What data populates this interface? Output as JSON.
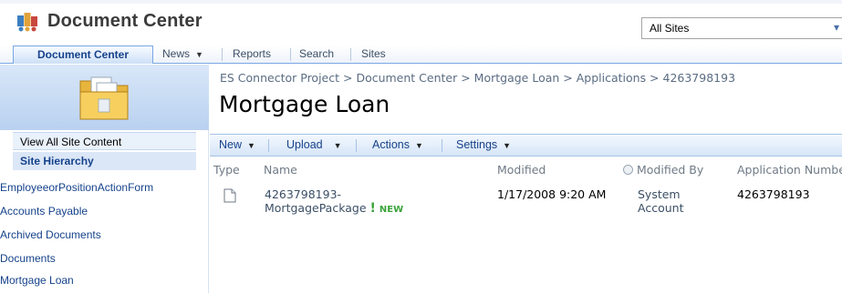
{
  "header": {
    "site_title": "Document Center",
    "scope_select": {
      "selected": "All Sites"
    }
  },
  "topnav": {
    "tabs": [
      {
        "label": "Document Center",
        "active": true
      },
      {
        "label": "News",
        "has_dropdown": true
      },
      {
        "label": "Reports"
      },
      {
        "label": "Search"
      },
      {
        "label": "Sites"
      }
    ]
  },
  "sidebar": {
    "view_all": "View All Site Content",
    "hierarchy_heading": "Site Hierarchy",
    "items": [
      "EmployeeorPositionActionForm",
      "Accounts Payable",
      "Archived Documents",
      "Documents",
      "Mortgage Loan"
    ]
  },
  "main": {
    "breadcrumb": "ES Connector Project > Document Center > Mortgage Loan > Applications > 4263798193",
    "title": "Mortgage Loan",
    "toolbar": {
      "new": "New",
      "upload": "Upload",
      "actions": "Actions",
      "settings": "Settings"
    },
    "columns": {
      "type": "Type",
      "name": "Name",
      "modified": "Modified",
      "modified_by": "Modified By",
      "application_number": "Application Numbe"
    },
    "rows": [
      {
        "name_line1": "4263798193-",
        "name_line2": "MortgagePackage",
        "new_badge": "NEW",
        "modified": "1/17/2008 9:20 AM",
        "modified_by_line1": "System",
        "modified_by_line2": "Account",
        "application_number": "4263798193"
      }
    ]
  },
  "colors": {
    "accent": "#15428b",
    "nav_border": "#79a7e3",
    "toolbar_border": "#a6c3e6",
    "new_badge": "#3aa43a"
  }
}
